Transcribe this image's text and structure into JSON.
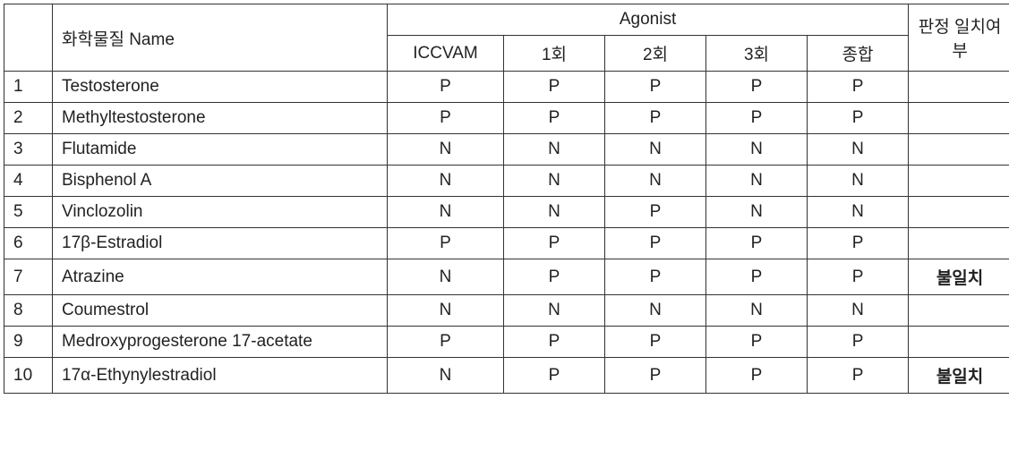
{
  "table": {
    "headers": {
      "chemical_name": "화학물질 Name",
      "agonist": "Agonist",
      "iccvam": "ICCVAM",
      "trial1": "1회",
      "trial2": "2회",
      "trial3": "3회",
      "summary": "종합",
      "agreement": "판정 일치여부"
    },
    "rows": [
      {
        "num": "1",
        "name": "Testosterone",
        "iccvam": "P",
        "t1": "P",
        "t2": "P",
        "t3": "P",
        "summary": "P",
        "result": ""
      },
      {
        "num": "2",
        "name": "Methyltestosterone",
        "iccvam": "P",
        "t1": "P",
        "t2": "P",
        "t3": "P",
        "summary": "P",
        "result": ""
      },
      {
        "num": "3",
        "name": "Flutamide",
        "iccvam": "N",
        "t1": "N",
        "t2": "N",
        "t3": "N",
        "summary": "N",
        "result": ""
      },
      {
        "num": "4",
        "name": "Bisphenol  A",
        "iccvam": "N",
        "t1": "N",
        "t2": "N",
        "t3": "N",
        "summary": "N",
        "result": ""
      },
      {
        "num": "5",
        "name": "Vinclozolin",
        "iccvam": "N",
        "t1": "N",
        "t2": "P",
        "t3": "N",
        "summary": "N",
        "result": ""
      },
      {
        "num": "6",
        "name": "17β-Estradiol",
        "iccvam": "P",
        "t1": "P",
        "t2": "P",
        "t3": "P",
        "summary": "P",
        "result": ""
      },
      {
        "num": "7",
        "name": "Atrazine",
        "iccvam": "N",
        "t1": "P",
        "t2": "P",
        "t3": "P",
        "summary": "P",
        "result": "불일치"
      },
      {
        "num": "8",
        "name": "Coumestrol",
        "iccvam": "N",
        "t1": "N",
        "t2": "N",
        "t3": "N",
        "summary": "N",
        "result": ""
      },
      {
        "num": "9",
        "name": "Medroxyprogesterone  17-acetate",
        "iccvam": "P",
        "t1": "P",
        "t2": "P",
        "t3": "P",
        "summary": "P",
        "result": ""
      },
      {
        "num": "10",
        "name": "17α-Ethynylestradiol",
        "iccvam": "N",
        "t1": "P",
        "t2": "P",
        "t3": "P",
        "summary": "P",
        "result": "불일치"
      }
    ]
  }
}
